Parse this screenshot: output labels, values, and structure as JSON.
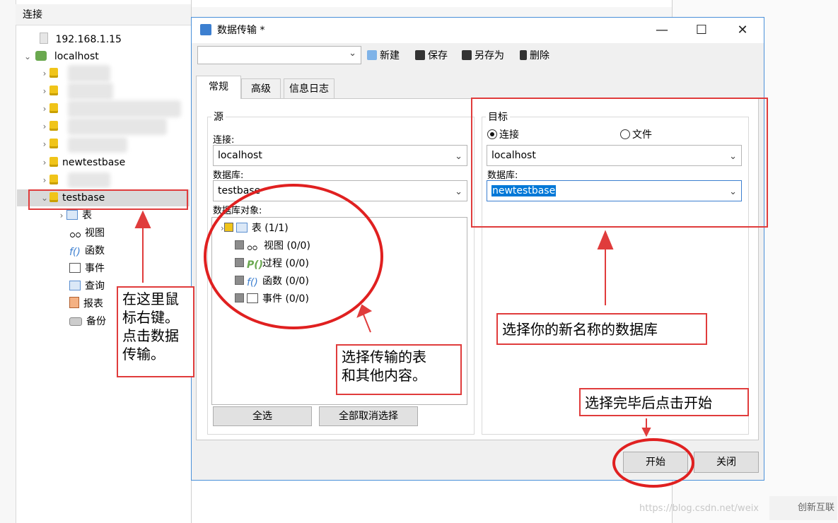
{
  "left_panel": {
    "header": "连接",
    "tree": [
      {
        "label": "192.168.1.15"
      },
      {
        "label": "localhost"
      },
      {
        "label": "newtestbase"
      },
      {
        "label": "testbase"
      }
    ],
    "children": [
      "表",
      "视图",
      "函数",
      "事件",
      "查询",
      "报表",
      "备份"
    ]
  },
  "dialog": {
    "title": "数据传输 *",
    "window_controls": {
      "minimize": "—",
      "maximize": "☐",
      "close": "✕"
    },
    "toolbar": {
      "new": "新建",
      "save": "保存",
      "save_as": "另存为",
      "delete": "删除"
    },
    "tabs": [
      "常规",
      "高级",
      "信息日志"
    ],
    "source": {
      "legend": "源",
      "connection_label": "连接:",
      "connection_value": "localhost",
      "database_label": "数据库:",
      "database_value": "testbase",
      "objects_label": "数据库对象:",
      "objects": [
        {
          "name": "表",
          "count": "(1/1)"
        },
        {
          "name": "视图",
          "count": "(0/0)"
        },
        {
          "name": "过程",
          "count": "(0/0)"
        },
        {
          "name": "函数",
          "count": "(0/0)"
        },
        {
          "name": "事件",
          "count": "(0/0)"
        }
      ],
      "select_all": "全选",
      "deselect_all": "全部取消选择"
    },
    "target": {
      "legend": "目标",
      "radio_connection": "连接",
      "radio_file": "文件",
      "connection_value": "localhost",
      "database_label": "数据库:",
      "database_value": "newtestbase"
    },
    "start_button": "开始",
    "close_button": "关闭"
  },
  "annotations": {
    "right_click": "在这里鼠标右键。点击数据传输。",
    "right_click_lines": [
      "在这里鼠",
      "标右键。",
      "点击数据",
      "传输。"
    ],
    "select_tables": [
      "选择传输的表",
      "和其他内容。"
    ],
    "select_db": "选择你的新名称的数据库",
    "click_start": "选择完毕后点击开始"
  },
  "watermark": "https://blog.csdn.net/weix",
  "logo": "创新互联",
  "colors": {
    "annotation_red": "#e03c3c",
    "selection_blue": "#0078d7",
    "db_icon": "#f0c419"
  }
}
